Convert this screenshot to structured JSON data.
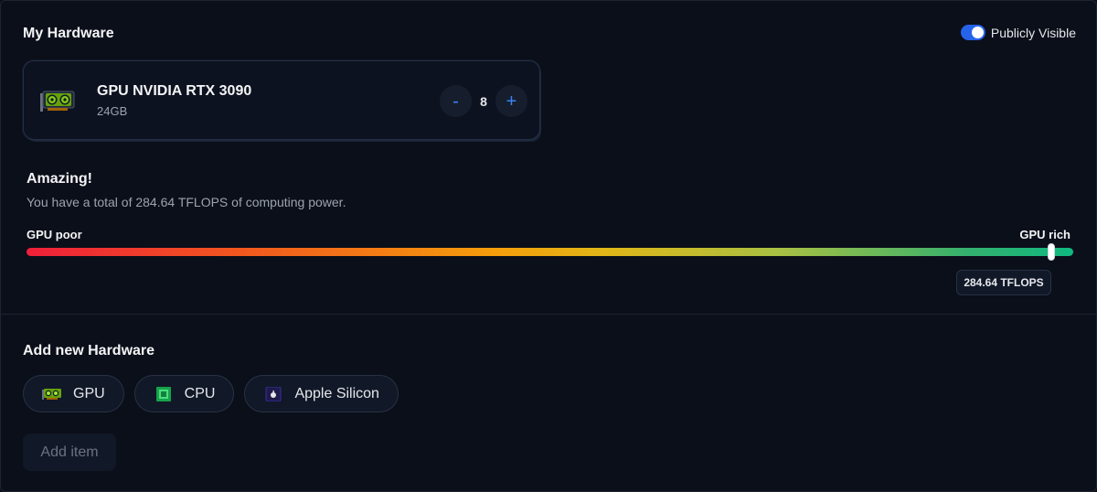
{
  "section": {
    "my_hardware_title": "My Hardware",
    "add_hardware_title": "Add new Hardware"
  },
  "visibility": {
    "label": "Publicly Visible",
    "enabled": true
  },
  "hardware_items": [
    {
      "type": "gpu",
      "name": "GPU NVIDIA RTX 3090",
      "memory": "24GB",
      "count_dec_label": "-",
      "count": "8",
      "count_inc_label": "+"
    }
  ],
  "summary": {
    "verdict": "Amazing!",
    "total_text": "You have a total of 284.64 TFLOPS of computing power."
  },
  "gauge": {
    "min_label": "GPU poor",
    "max_label": "GPU rich",
    "value_label": "284.64 TFLOPS",
    "fraction": 0.979
  },
  "add_options": [
    {
      "label": "GPU",
      "icon": "gpu-icon"
    },
    {
      "label": "CPU",
      "icon": "cpu-icon"
    },
    {
      "label": "Apple Silicon",
      "icon": "apple-silicon-icon"
    }
  ],
  "add_item_button": "Add item",
  "colors": {
    "background": "#0b0f19",
    "accent": "#2563eb",
    "stepper": "#3b82f6",
    "gauge_start": "#ef1f3a",
    "gauge_mid": "#f59e0b",
    "gauge_end": "#10b981"
  }
}
